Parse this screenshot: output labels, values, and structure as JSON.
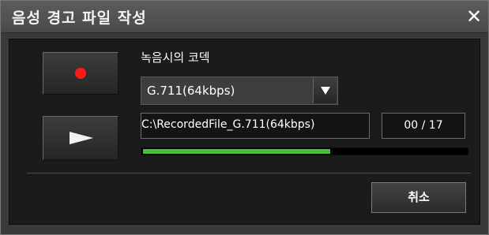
{
  "window": {
    "title": "음성 경고 파일 작성",
    "close_icon": "close-icon",
    "close_glyph": "✕"
  },
  "recorder": {
    "record_icon": "record-dot-icon",
    "play_icon": "play-icon",
    "record_color": "#ff1a1a",
    "codec_label": "녹음시의 코덱",
    "codec_selected": "G.711(64kbps)",
    "file_path": "C:\\RecordedFile_G.711(64kbps)",
    "counter": "00 / 17",
    "progress": 0.58,
    "progress_color": "#44c23a"
  },
  "footer": {
    "cancel_label": "취소"
  }
}
